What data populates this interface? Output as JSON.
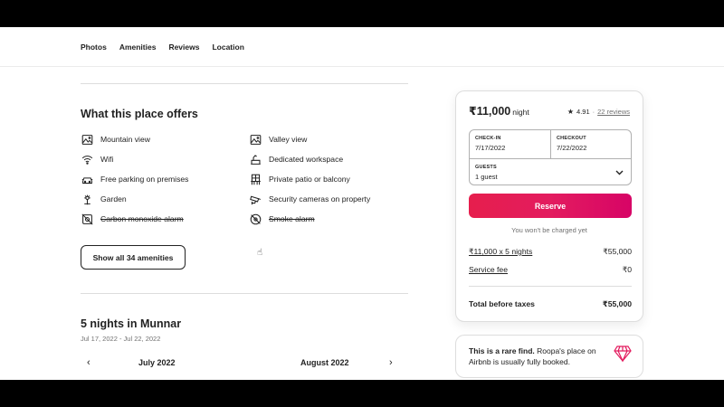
{
  "nav": {
    "tabs": [
      "Photos",
      "Amenities",
      "Reviews",
      "Location"
    ]
  },
  "offers": {
    "title": "What this place offers",
    "left": [
      {
        "icon": "mountain-view-icon",
        "label": "Mountain view",
        "unavailable": false
      },
      {
        "icon": "wifi-icon",
        "label": "Wifi",
        "unavailable": false
      },
      {
        "icon": "car-icon",
        "label": "Free parking on premises",
        "unavailable": false
      },
      {
        "icon": "garden-icon",
        "label": "Garden",
        "unavailable": false
      },
      {
        "icon": "no-co-alarm-icon",
        "label": "Carbon monoxide alarm",
        "unavailable": true
      }
    ],
    "right": [
      {
        "icon": "valley-view-icon",
        "label": "Valley view",
        "unavailable": false
      },
      {
        "icon": "workspace-icon",
        "label": "Dedicated workspace",
        "unavailable": false
      },
      {
        "icon": "patio-icon",
        "label": "Private patio or balcony",
        "unavailable": false
      },
      {
        "icon": "security-camera-icon",
        "label": "Security cameras on property",
        "unavailable": false
      },
      {
        "icon": "no-smoke-alarm-icon",
        "label": "Smoke alarm",
        "unavailable": true
      }
    ],
    "show_all_label": "Show all 34 amenities"
  },
  "stay": {
    "title": "5 nights in Munnar",
    "dates": "Jul 17, 2022 - Jul 22, 2022",
    "month_left": "July 2022",
    "month_right": "August 2022"
  },
  "booking": {
    "price": "₹11,000",
    "per": "night",
    "rating": "4.91",
    "separator": "·",
    "reviews": "22 reviews",
    "checkin_label": "CHECK-IN",
    "checkin_value": "7/17/2022",
    "checkout_label": "CHECKOUT",
    "checkout_value": "7/22/2022",
    "guests_label": "GUESTS",
    "guests_value": "1 guest",
    "reserve_label": "Reserve",
    "no_charge": "You won't be charged yet",
    "nightly_label": "₹11,000 x 5 nights",
    "nightly_value": "₹55,000",
    "fee_label": "Service fee",
    "fee_value": "₹0",
    "total_label": "Total before taxes",
    "total_value": "₹55,000",
    "accent": "#e31c5f"
  },
  "rare": {
    "bold": "This is a rare find.",
    "text": "Roopa's place on Airbnb is usually fully booked."
  }
}
